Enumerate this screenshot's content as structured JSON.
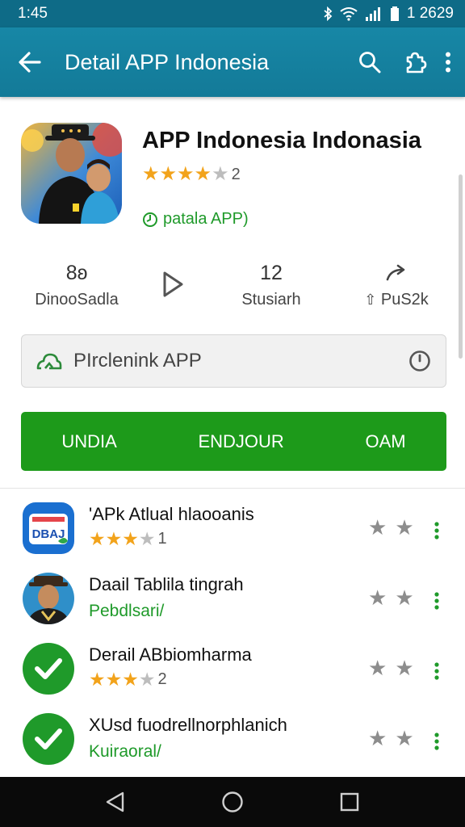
{
  "status_bar": {
    "time": "1:45",
    "right_text": "1 2629"
  },
  "app_bar": {
    "title": "Detail APP Indonesia"
  },
  "app": {
    "name": "APP Indonesia Indonasia",
    "rating": 4,
    "rating_count": "2",
    "developer": "patala APP)"
  },
  "stats": [
    {
      "value": "8ʚ",
      "label": "DinooSadla"
    },
    {
      "value": "12",
      "label": "Stusiarh"
    },
    {
      "value": "",
      "label": "PuS2k"
    }
  ],
  "search": {
    "placeholder": "PIrclenink APP"
  },
  "actions": [
    "UNDIA",
    "ENDJOUR",
    "OAM"
  ],
  "list": [
    {
      "title": "'APk Atlual hlaooanis",
      "rating": 3,
      "rating_count": "1",
      "icon": "app-badge-icon",
      "icon_text": "DBAJ"
    },
    {
      "title": "Daail Tablila tingrah",
      "subtitle": "Pebdlsari/",
      "icon": "person-avatar-icon"
    },
    {
      "title": "Derail ABbiomharma",
      "rating": 3,
      "rating_count": "2",
      "icon": "check-circle-icon"
    },
    {
      "title": "XUsd fuodrellnorphlanich",
      "subtitle": "Kuiraoral/",
      "icon": "check-circle-icon"
    }
  ],
  "colors": {
    "primary": "#137a98",
    "accent_green": "#1d9a1a",
    "star": "#f2a31b"
  }
}
